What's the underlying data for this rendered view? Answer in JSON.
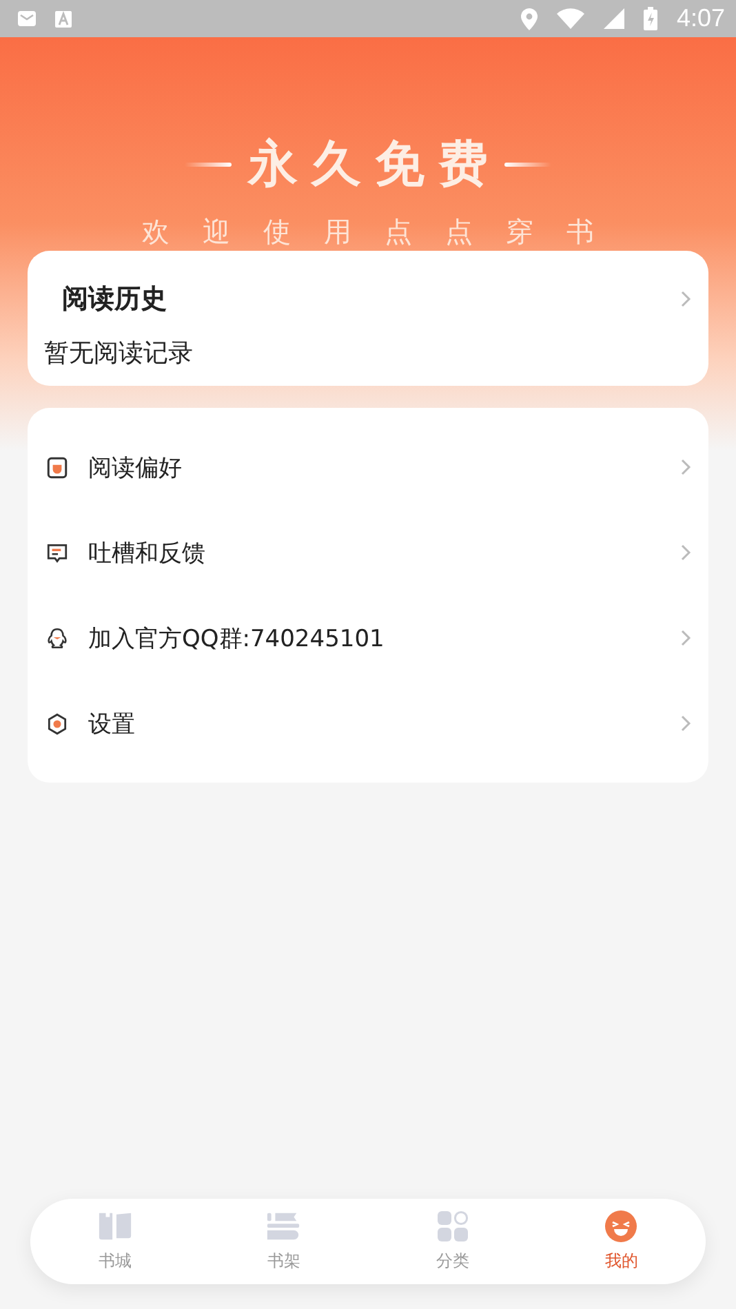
{
  "status_bar": {
    "time": "4:07"
  },
  "banner": {
    "title": "永久免费",
    "subtitle": "欢迎使用点点穿书"
  },
  "history": {
    "title": "阅读历史",
    "empty_text": "暂无阅读记录"
  },
  "menu": [
    {
      "kind": "preference",
      "label": "阅读偏好"
    },
    {
      "kind": "feedback",
      "label": "吐槽和反馈"
    },
    {
      "kind": "group",
      "label": "加入官方QQ群:740245101"
    },
    {
      "kind": "settings",
      "label": "设置"
    }
  ],
  "tabs": [
    {
      "kind": "store",
      "label": "书城",
      "selected": false
    },
    {
      "kind": "shelf",
      "label": "书架",
      "selected": false
    },
    {
      "kind": "category",
      "label": "分类",
      "selected": false
    },
    {
      "kind": "me",
      "label": "我的",
      "selected": true
    }
  ]
}
